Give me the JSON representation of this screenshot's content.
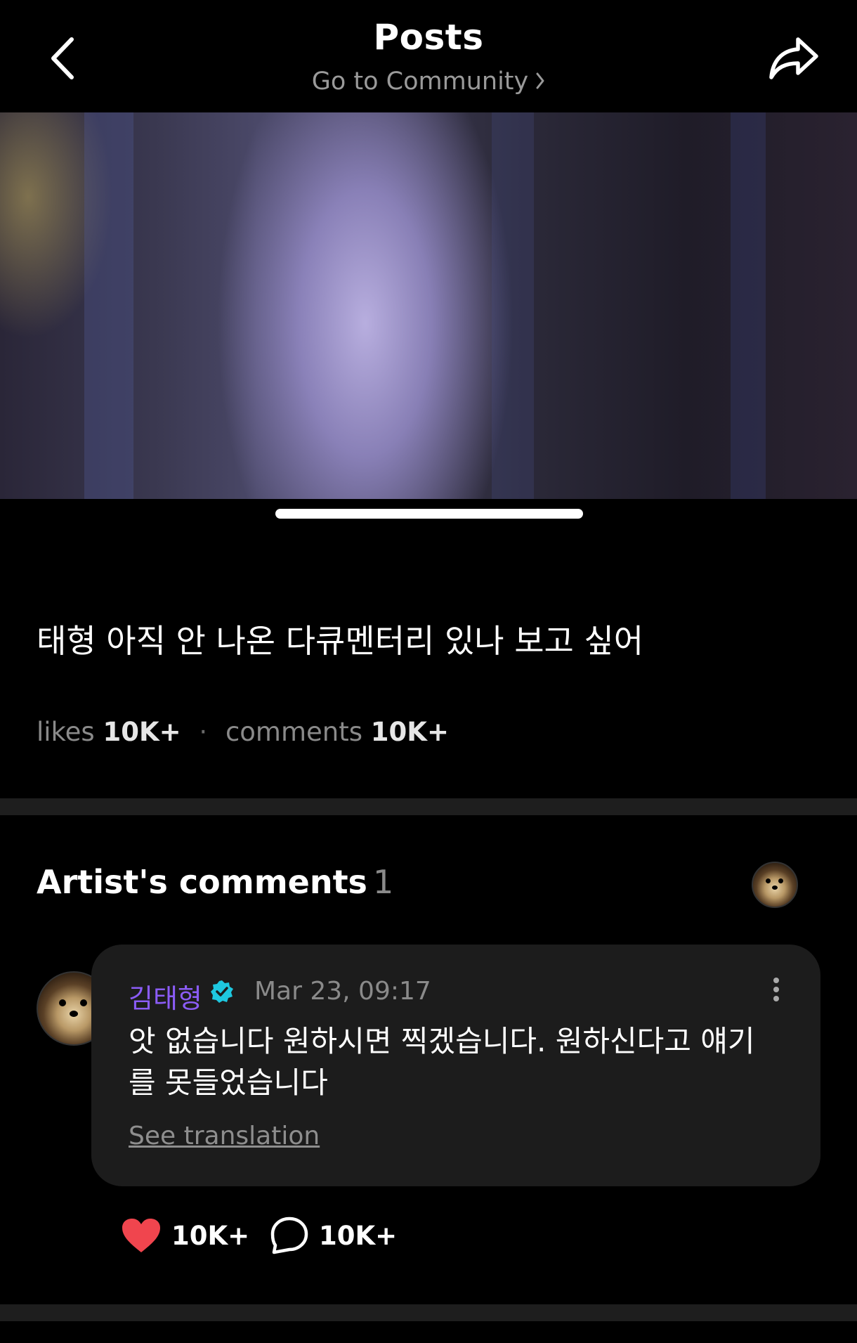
{
  "header": {
    "title": "Posts",
    "subtitle": "Go to Community"
  },
  "post": {
    "text": "태형 아직 안 나온 다큐멘터리 있나 보고 싶어",
    "stats": {
      "likes_label": "likes",
      "likes_value": "10K+",
      "comments_label": "comments",
      "comments_value": "10K+"
    },
    "media_pager_progress": 1.0
  },
  "artist_comments": {
    "title": "Artist's comments",
    "count": "1",
    "comments": [
      {
        "author": "김태형",
        "verified": true,
        "timestamp": "Mar 23, 09:17",
        "text": "앗 없습니다 원하시면 찍겠습니다. 원하신다고 얘기를 못들었습니다",
        "translate_label": "See translation",
        "likes": "10K+",
        "replies": "10K+"
      }
    ]
  },
  "colors": {
    "background": "#000000",
    "author_name": "#8b5cf6",
    "verified_badge": "#1ec8e0",
    "heart": "#f0454e",
    "card": "#1c1c1c"
  },
  "icons": {
    "back": "chevron-left-icon",
    "share": "share-arrow-icon",
    "more": "more-vertical-icon",
    "like": "heart-icon",
    "reply": "comment-bubble-icon"
  }
}
